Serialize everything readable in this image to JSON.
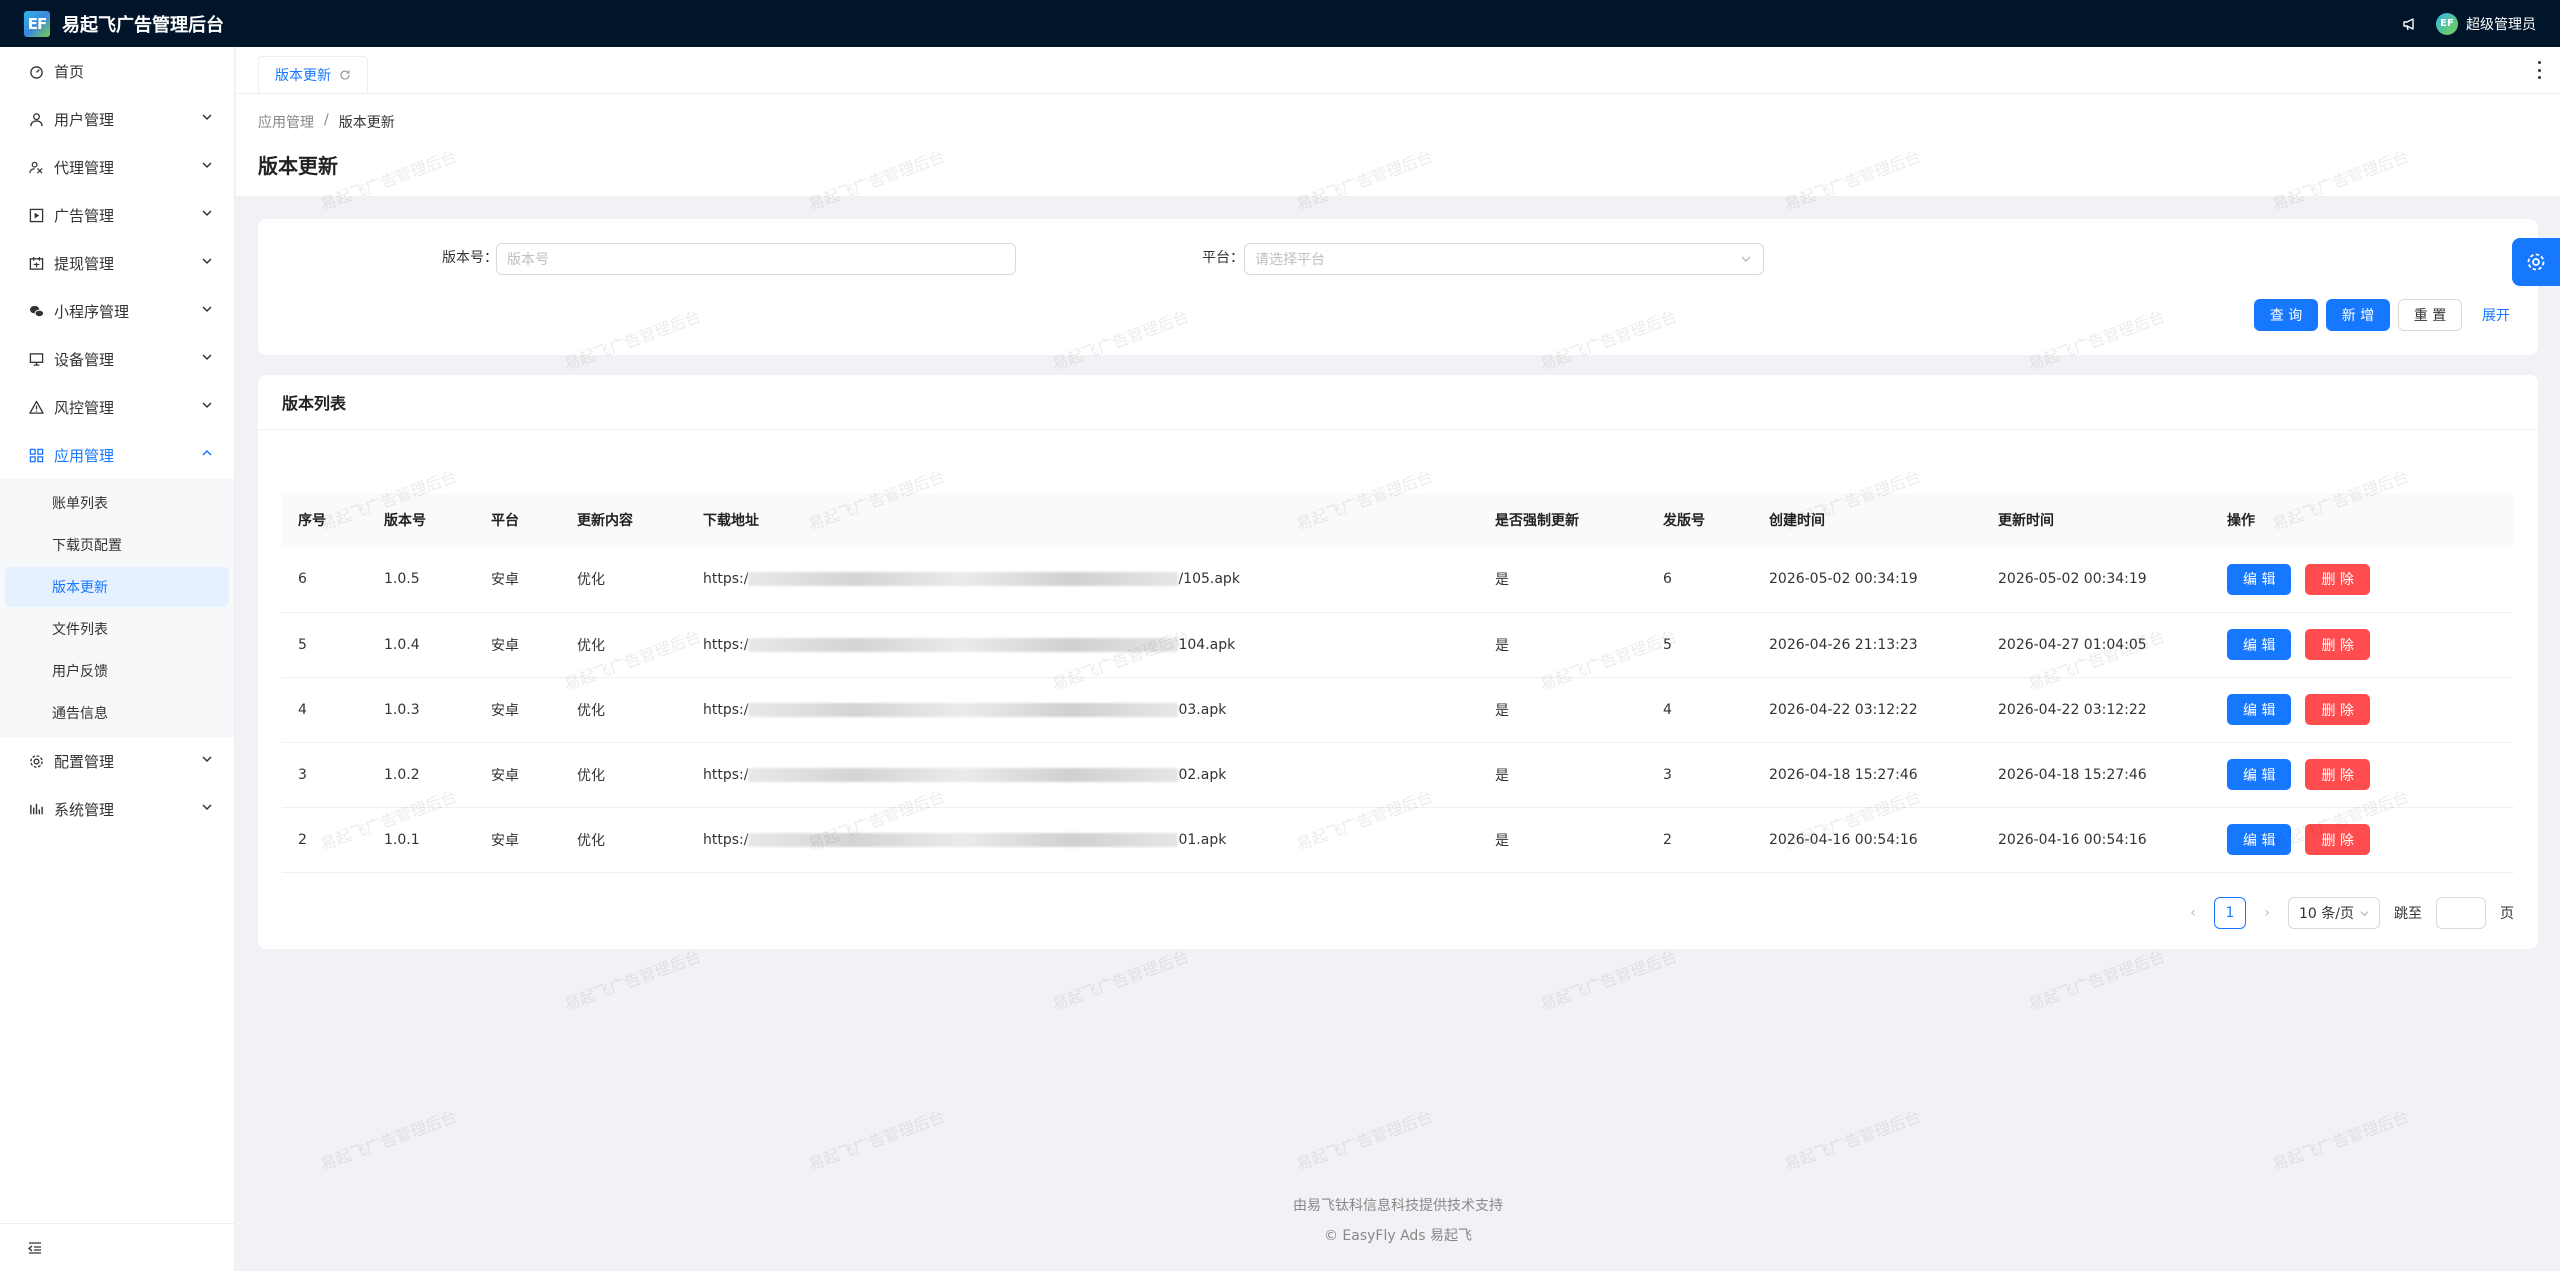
{
  "app": {
    "logo_text": "EF",
    "title": "易起飞广告管理后台"
  },
  "header": {
    "user_name": "超级管理员",
    "avatar_text": "EF"
  },
  "sidebar": {
    "items": [
      {
        "label": "首页",
        "icon": "dashboard-icon"
      },
      {
        "label": "用户管理",
        "icon": "user-icon"
      },
      {
        "label": "代理管理",
        "icon": "agent-icon"
      },
      {
        "label": "广告管理",
        "icon": "ad-icon"
      },
      {
        "label": "提现管理",
        "icon": "withdraw-icon"
      },
      {
        "label": "小程序管理",
        "icon": "wechat-icon"
      },
      {
        "label": "设备管理",
        "icon": "device-icon"
      },
      {
        "label": "风控管理",
        "icon": "warning-icon"
      },
      {
        "label": "应用管理",
        "icon": "apps-icon"
      },
      {
        "label": "配置管理",
        "icon": "gear-icon"
      },
      {
        "label": "系统管理",
        "icon": "system-icon"
      }
    ],
    "sub_items": [
      "账单列表",
      "下载页配置",
      "版本更新",
      "文件列表",
      "用户反馈",
      "通告信息"
    ]
  },
  "tabs": {
    "active": "版本更新"
  },
  "breadcrumb": {
    "parent": "应用管理",
    "separator": "/",
    "current": "版本更新"
  },
  "page": {
    "title": "版本更新"
  },
  "search": {
    "version_label": "版本号：",
    "version_placeholder": "版本号",
    "platform_label": "平台：",
    "platform_placeholder": "请选择平台",
    "query_btn": "查 询",
    "add_btn": "新 增",
    "reset_btn": "重 置",
    "expand_link": "展开"
  },
  "list": {
    "title": "版本列表",
    "columns": [
      "序号",
      "版本号",
      "平台",
      "更新内容",
      "下载地址",
      "是否强制更新",
      "发版号",
      "创建时间",
      "更新时间",
      "操作"
    ],
    "rows": [
      {
        "id": "6",
        "version": "1.0.5",
        "platform": "安卓",
        "content": "优化",
        "url_prefix": "https:/",
        "url_suffix": "/105.apk",
        "force": "是",
        "release": "6",
        "created": "2026-05-02 00:34:19",
        "updated": "2026-05-02 00:34:19"
      },
      {
        "id": "5",
        "version": "1.0.4",
        "platform": "安卓",
        "content": "优化",
        "url_prefix": "https:/",
        "url_suffix": "104.apk",
        "force": "是",
        "release": "5",
        "created": "2026-04-26 21:13:23",
        "updated": "2026-04-27 01:04:05"
      },
      {
        "id": "4",
        "version": "1.0.3",
        "platform": "安卓",
        "content": "优化",
        "url_prefix": "https:/",
        "url_suffix": "03.apk",
        "force": "是",
        "release": "4",
        "created": "2026-04-22 03:12:22",
        "updated": "2026-04-22 03:12:22"
      },
      {
        "id": "3",
        "version": "1.0.2",
        "platform": "安卓",
        "content": "优化",
        "url_prefix": "https:/",
        "url_suffix": "02.apk",
        "force": "是",
        "release": "3",
        "created": "2026-04-18 15:27:46",
        "updated": "2026-04-18 15:27:46"
      },
      {
        "id": "2",
        "version": "1.0.1",
        "platform": "安卓",
        "content": "优化",
        "url_prefix": "https:/",
        "url_suffix": "01.apk",
        "force": "是",
        "release": "2",
        "created": "2026-04-16 00:54:16",
        "updated": "2026-04-16 00:54:16"
      }
    ],
    "edit_label": "编 辑",
    "delete_label": "删 除"
  },
  "pagination": {
    "prev": "‹",
    "page": "1",
    "next": "›",
    "page_size": "10 条/页",
    "jump_label": "跳至",
    "page_unit": "页"
  },
  "footer": {
    "line1": "由易飞钛科信息科技提供技术支持",
    "line2": "EasyFly Ads 易起飞",
    "copyright_symbol": "©"
  },
  "watermark": "易起飞广告管理后台",
  "colors": {
    "primary": "#1677ff",
    "danger": "#ff4d4f",
    "header_bg": "#001529"
  }
}
